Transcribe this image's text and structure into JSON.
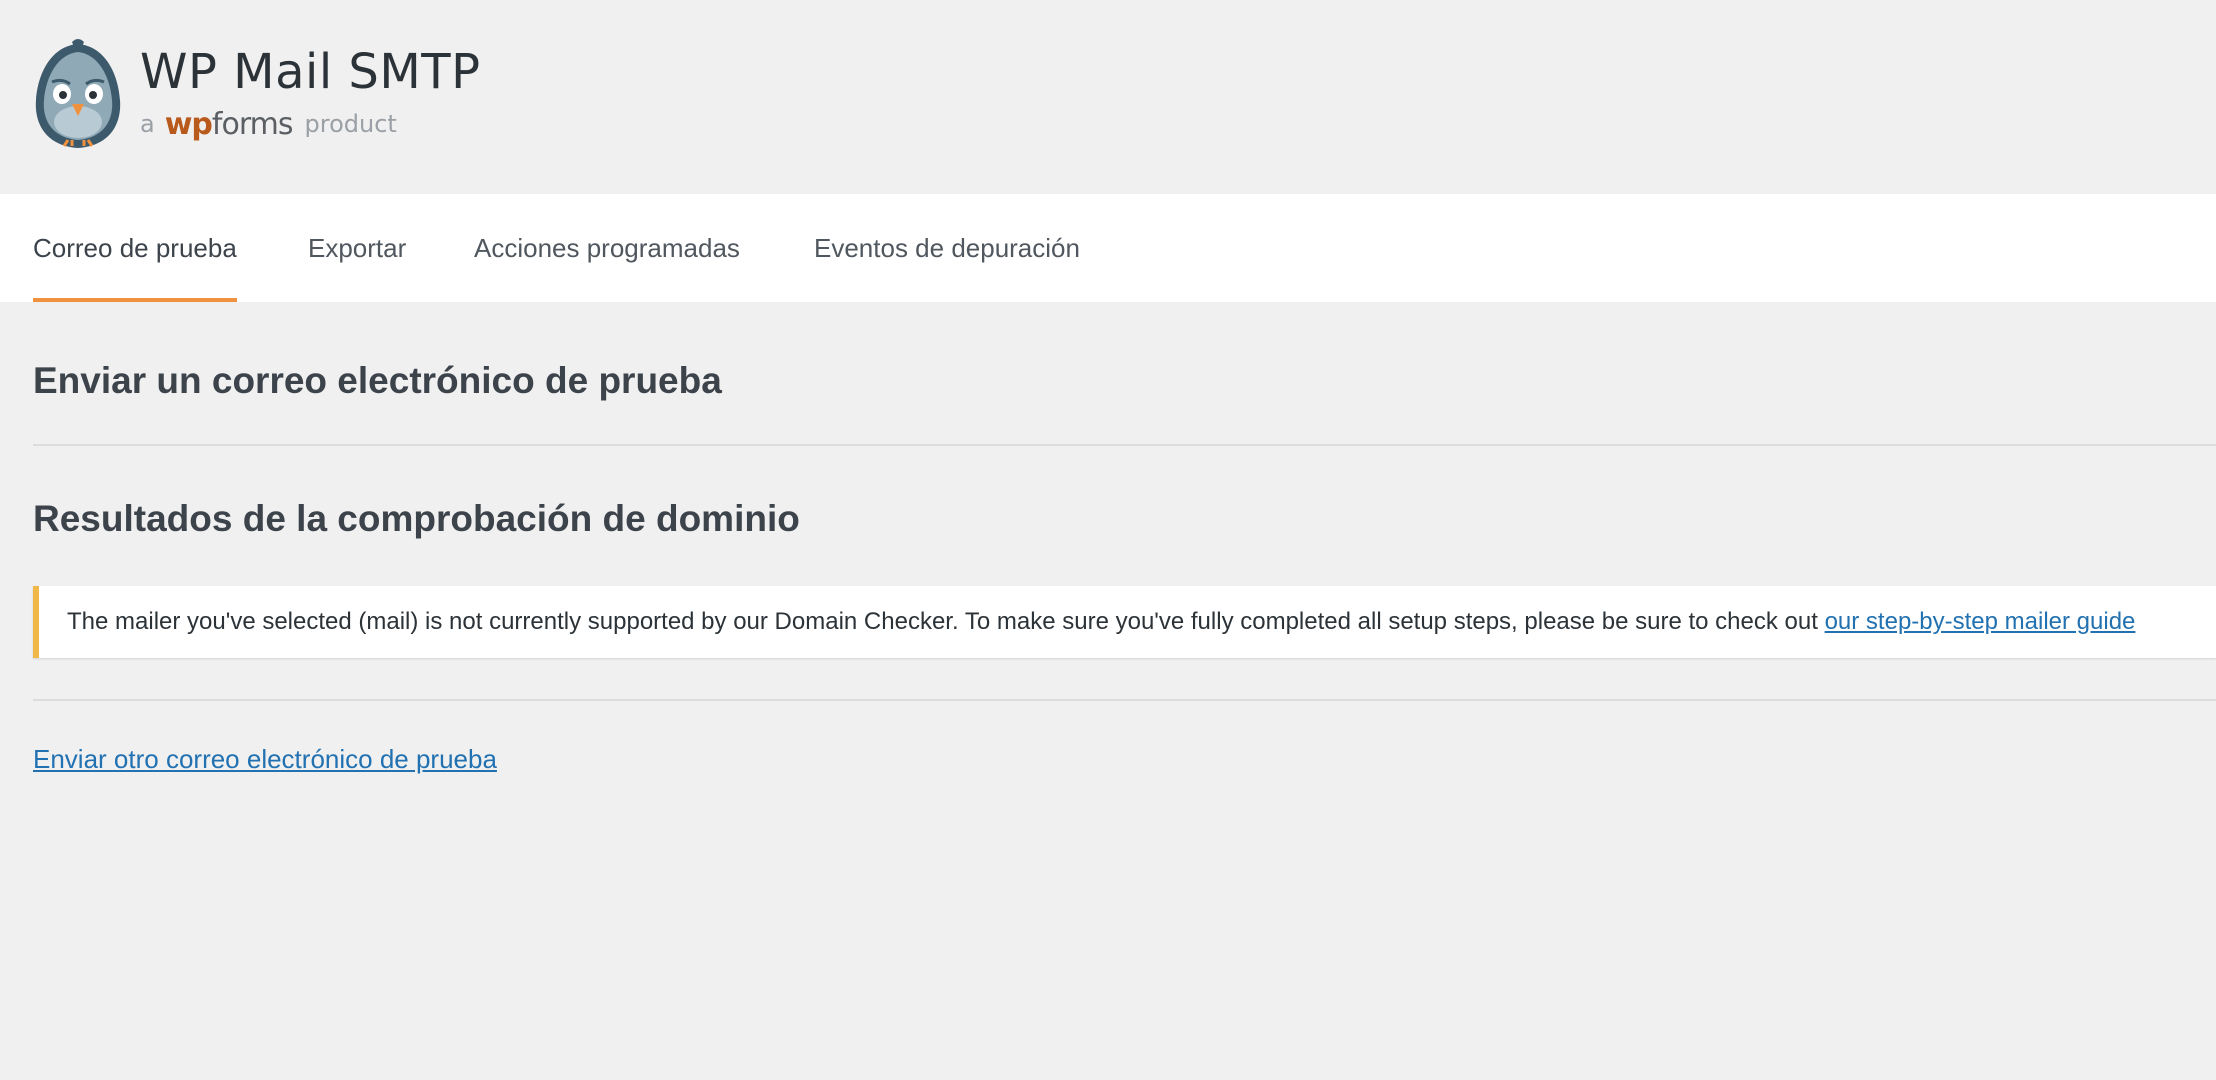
{
  "header": {
    "logo_icon": "pigeon-mascot-icon",
    "title": "WP Mail SMTP",
    "byline": {
      "prefix": "a",
      "brand_wp": "wp",
      "brand_forms": "forms",
      "suffix": "product"
    }
  },
  "tabs": [
    {
      "label": "Correo de prueba",
      "active": true
    },
    {
      "label": "Exportar",
      "active": false
    },
    {
      "label": "Acciones programadas",
      "active": false
    },
    {
      "label": "Eventos de depuración",
      "active": false
    }
  ],
  "main": {
    "send_test_heading": "Enviar un correo electrónico de prueba",
    "domain_results_heading": "Resultados de la comprobación de dominio",
    "notice": {
      "text": "The mailer you've selected (mail) is not currently supported by our Domain Checker. To make sure you've fully completed all setup steps, please be sure to check out ",
      "link_text": "our step-by-step mailer guide"
    },
    "send_another_link": "Enviar otro correo electrónico de prueba"
  },
  "colors": {
    "page_background": "#f0f0f1",
    "tab_active_indicator": "#f0913f",
    "notice_warning_border": "#f0b849",
    "link": "#2271b1",
    "wp_brand": "#b85a1b"
  }
}
